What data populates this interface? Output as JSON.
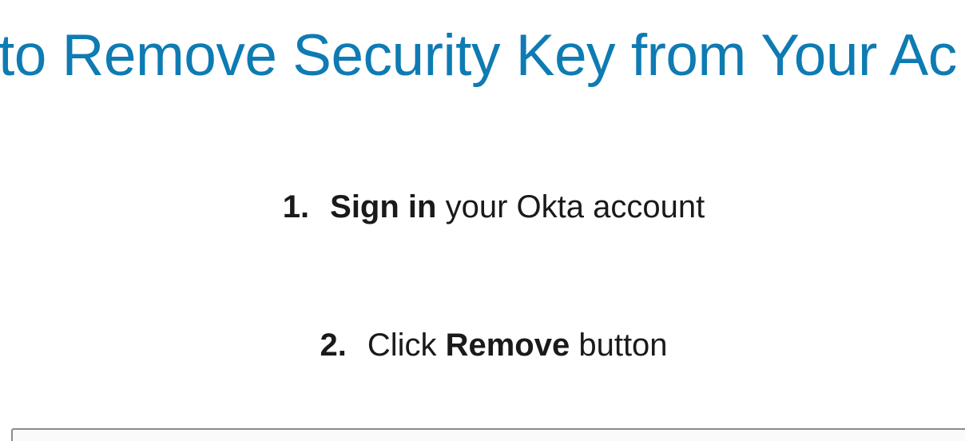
{
  "page": {
    "title": "to Remove Security Key from Your Ac"
  },
  "steps": [
    {
      "number": "1.",
      "emphasis": "Sign in",
      "before": "",
      "after": " your Okta account"
    },
    {
      "number": "2.",
      "before": "Click ",
      "emphasis": "Remove",
      "after": " button"
    }
  ],
  "colors": {
    "title": "#0e7bb3",
    "body_text": "#1a1a1a",
    "frame_border": "#8a8a8a"
  }
}
